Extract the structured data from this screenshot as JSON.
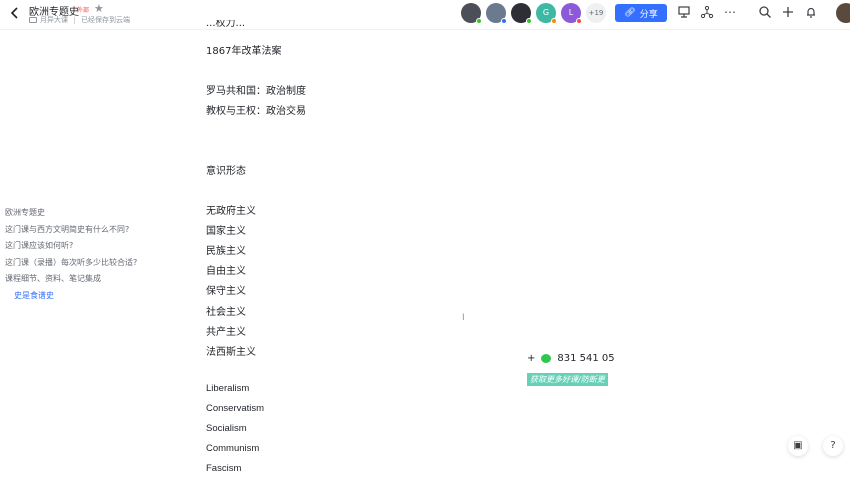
{
  "header": {
    "title": "欧洲专题史",
    "external_tag": "外部",
    "folder": "月异大课",
    "save_status": "已经保存到云端",
    "more_collaborators": "+19",
    "share_label": "分享",
    "collaborators": [
      {
        "letter": "",
        "color": "#4a4f58",
        "status": "#34c724"
      },
      {
        "letter": "",
        "color": "#6b7a8f",
        "status": "#3370ff"
      },
      {
        "letter": "",
        "color": "#2e2f36",
        "status": "#34c724"
      },
      {
        "letter": "G",
        "color": "#3cb8a4",
        "status": "#ff8800"
      },
      {
        "letter": "L",
        "color": "#8c5ad9",
        "status": "#f54a45"
      }
    ]
  },
  "outline": {
    "items": [
      {
        "label": "欧洲专题史",
        "sub": false,
        "active": false
      },
      {
        "label": "这门课与西方文明简史有什么不同?",
        "sub": false,
        "active": false
      },
      {
        "label": "这门课应该如何听?",
        "sub": false,
        "active": false
      },
      {
        "label": "这门课（录播）每次听多少比较合适?",
        "sub": false,
        "active": false
      },
      {
        "label": "课程细节、资料、笔记集成",
        "sub": false,
        "active": false
      },
      {
        "label": "史是食谱史",
        "sub": true,
        "active": true
      }
    ]
  },
  "document": {
    "cut_top_line": "...权力...",
    "lines": [
      "1867年改革法案",
      "",
      "罗马共和国：政治制度",
      "教权与王权：政治交易",
      "",
      "",
      "意识形态",
      "",
      "无政府主义",
      "国家主义",
      "民族主义",
      "自由主义",
      "保守主义",
      "社会主义",
      "共产主义",
      "法西斯主义",
      "",
      "Liberalism",
      "Conservatism",
      "Socialism",
      "Communism",
      "Fascism"
    ]
  },
  "overlay": {
    "plus": "+",
    "contact_numbers": "831    541    05",
    "promo_text": "获取更多好课/防断更"
  },
  "floating": {
    "doc_icon": "▣",
    "help_icon": "?"
  }
}
